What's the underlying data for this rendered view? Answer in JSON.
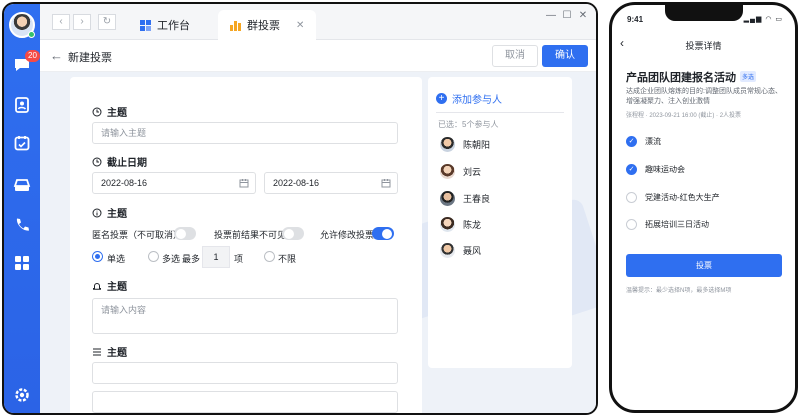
{
  "desktop": {
    "sidebar": {
      "badge_count": "20",
      "icons": [
        "chat-icon",
        "contacts-icon",
        "calendar-icon",
        "drive-icon",
        "phone-icon",
        "apps-grid-icon",
        "settings-icon"
      ]
    },
    "tabs": [
      {
        "label": "工作台",
        "icon": "workspace-icon"
      },
      {
        "label": "群投票",
        "icon": "bar-chart-icon"
      }
    ],
    "header": {
      "title": "新建投票",
      "cancel_label": "取消",
      "confirm_label": "确认"
    },
    "form": {
      "topic_label": "主题",
      "topic_placeholder": "请输入主题",
      "deadline_label": "截止日期",
      "date_start": "2022-08-16",
      "date_end": "2022-08-16",
      "options_title": "主题",
      "anonymous_label": "匿名投票（不可取消）",
      "hide_result_label": "投票前结果不可见",
      "allow_edit_label": "允许修改投票",
      "single_label": "单选",
      "multi_label": "多选",
      "max_label": "最多",
      "max_value": "1",
      "item_unit": "项",
      "unlimited_label": "不限",
      "content_label": "主题",
      "content_placeholder": "请输入内容",
      "list_label": "主题"
    },
    "members_panel": {
      "add_label": "添加参与人",
      "selected_text": "已选：5个参与人",
      "members": [
        "陈朝阳",
        "刘云",
        "王春良",
        "陈龙",
        "聂风"
      ]
    }
  },
  "mobile": {
    "time": "9:41",
    "title": "投票详情",
    "vote_title": "产品团队团建报名活动",
    "tag": "多选",
    "description": "达成企业团队熔炼的目的:调整团队成员常规心态、增强凝聚力、注入创业激情",
    "meta": "张程程 · 2023-09-21 16:00 (截止) · 2人投票",
    "options": [
      {
        "label": "漂流",
        "checked": true
      },
      {
        "label": "趣味运动会",
        "checked": true
      },
      {
        "label": "党建活动-红色大生产",
        "checked": false
      },
      {
        "label": "拓展培训三日活动",
        "checked": false
      }
    ],
    "vote_button": "投票",
    "hint": "温馨提示：最少选择N项，最多选择M项"
  },
  "colors": {
    "primary": "#2f6ff0",
    "sidebar": "#2b63e6",
    "badge": "#f54a45"
  }
}
